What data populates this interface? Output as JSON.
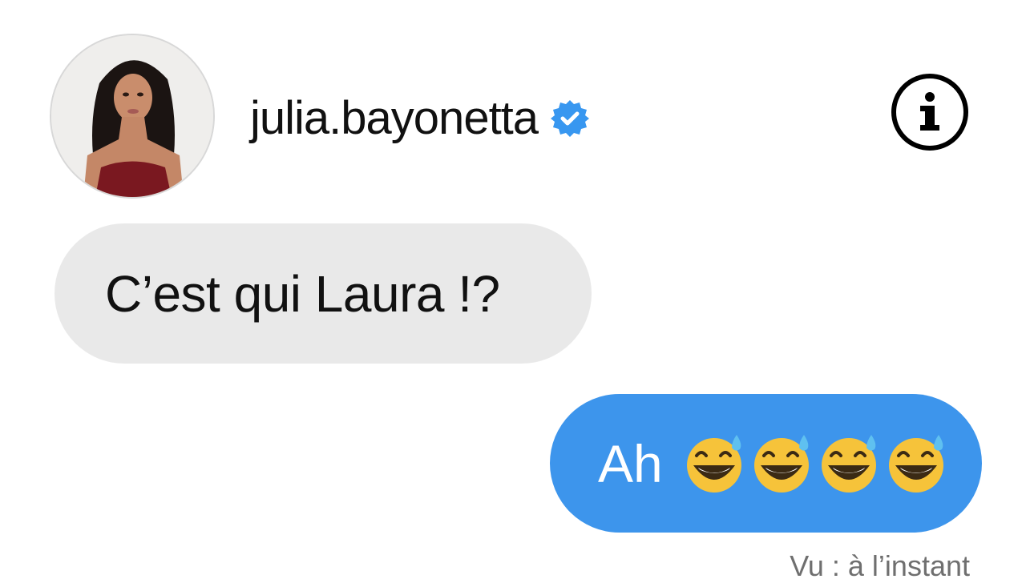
{
  "header": {
    "username": "julia.bayonetta",
    "verified_icon": "verified-badge-icon",
    "info_icon": "info-icon",
    "verified_color": "#3897f0"
  },
  "messages": [
    {
      "direction": "incoming",
      "text": "C’est qui Laura !?",
      "bubble_color": "#e9e9e9"
    },
    {
      "direction": "outgoing",
      "text": "Ah",
      "emojis": [
        "grinning-face-with-sweat-emoji",
        "grinning-face-with-sweat-emoji",
        "grinning-face-with-sweat-emoji",
        "grinning-face-with-sweat-emoji"
      ],
      "bubble_color": "#3d95ec"
    }
  ],
  "status": {
    "seen_text": "Vu : à l’instant"
  }
}
